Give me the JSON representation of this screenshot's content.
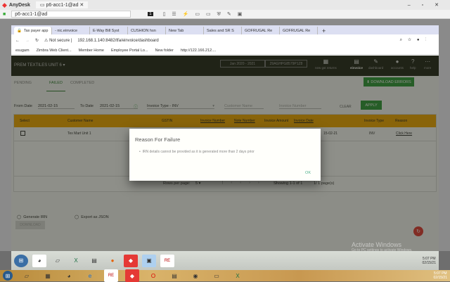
{
  "anydesk": {
    "app": "AnyDesk",
    "tab": "p6-acc1-1@ad",
    "address": "p6-acc1-1@ad",
    "monitor": "1"
  },
  "browser": {
    "tabs": [
      "Tax payer app",
      "- nic.einvoice",
      "E-Way Bill Syst",
      "CUSHION hsn",
      "New Tab",
      "Sales and SR S",
      "GOFRUGAL Re",
      "GOFRUGAL Re"
    ],
    "not_secure": "Not secure",
    "url": "192.168.1.140:8482/tfa/einvoice/dashboard",
    "bookmarks": [
      "esugam",
      "Zimbra Web Client...",
      "Member Home",
      "Employee Portal Lo...",
      "New folder",
      "http://122.166.212...."
    ]
  },
  "app": {
    "company": "PREM TEXTILES UNIT 6",
    "fy": "Jan 2020 - 2021",
    "gstin": "29AGHPG8579P1Z8",
    "nav": [
      {
        "label": "new gst returns",
        "icon": "grid-icon"
      },
      {
        "label": "einvoice",
        "icon": "document-icon"
      },
      {
        "label": "dashboard",
        "icon": "pencil-icon"
      },
      {
        "label": "accounts",
        "icon": "person-icon"
      },
      {
        "label": "help",
        "icon": "help-icon"
      },
      {
        "label": "more",
        "icon": "more-icon"
      }
    ],
    "tabs": [
      "PENDING",
      "FAILED",
      "COMPLETED"
    ],
    "download_errors": "DOWNLOAD ERRORS",
    "filters": {
      "from_label": "From Date",
      "from": "2021-02-15",
      "to_label": "To Date",
      "to": "2021-02-15",
      "invoice_type": "Invoice Type - INV",
      "customer_placeholder": "Customer Name",
      "invoice_placeholder": "Invoice Number",
      "clear": "CLEAR",
      "apply": "APPLY"
    },
    "table": {
      "headers": [
        "Select",
        "Customer Name",
        "GSTIN",
        "Invoice Number",
        "Note Number",
        "Invoice Amount",
        "Invoice Date",
        "Invoice Type",
        "Reason"
      ],
      "row": {
        "customer": "Tex Mart Unit 1",
        "date": "15-02-21",
        "type": "INV",
        "reason": "Click Here"
      }
    },
    "pagination": {
      "rows_label": "Rows per page:",
      "rows": "5",
      "showing": "Showing 1-1 of 1",
      "pages": "1/ 1 page(s)"
    },
    "options": [
      "Generate IRN",
      "Export as JSON"
    ],
    "download": "DOWNLOAD"
  },
  "modal": {
    "title": "Reason For Failure",
    "message": "IRN details cannot be provided as it is generated more than 2 days prior",
    "ok": "OK"
  },
  "watermark": {
    "title": "Activate Windows",
    "sub": "Go to PC settings to activate Windows."
  },
  "clock": {
    "time": "5:07 PM",
    "date": "02/15/21"
  }
}
